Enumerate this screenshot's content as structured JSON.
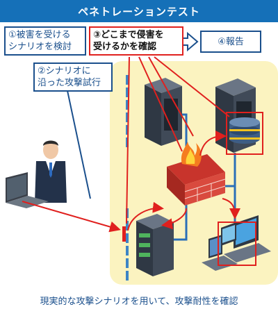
{
  "title": "ペネトレーションテスト",
  "steps": {
    "step1": "①被害を受ける\nシナリオを検討",
    "step2": "②シナリオに\n沿った攻撃試行",
    "step3": "③どこまで侵害を\n受けるかを確認",
    "step4": "④報告"
  },
  "caption": "現実的な攻撃シナリオを用いて、攻撃耐性を確認",
  "colors": {
    "title_bar": "#1570b8",
    "accent_red": "#e0201e",
    "dark_blue": "#1a4f8c",
    "background_zone": "#fbf3c0"
  }
}
